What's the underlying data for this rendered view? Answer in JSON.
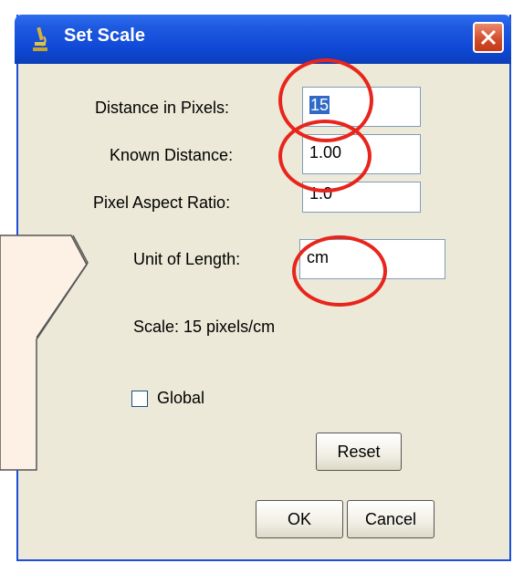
{
  "window": {
    "title": "Set Scale",
    "title_icon": "microscope-icon",
    "close_icon": "close-icon"
  },
  "form": {
    "distance_label": "Distance in Pixels:",
    "distance_value": "15",
    "known_label": "Known Distance:",
    "known_value": "1.00",
    "aspect_label": "Pixel Aspect Ratio:",
    "aspect_value": "1.0",
    "unit_label": "Unit of Length:",
    "unit_value": "cm",
    "scale_text": "Scale: 15 pixels/cm",
    "global_label": "Global",
    "global_checked": false
  },
  "buttons": {
    "reset": "Reset",
    "ok": "OK",
    "cancel": "Cancel"
  },
  "colors": {
    "annotation_circle": "#e8251c",
    "callout_fill": "#fdf1e6",
    "titlebar": "#1e5ae0"
  }
}
